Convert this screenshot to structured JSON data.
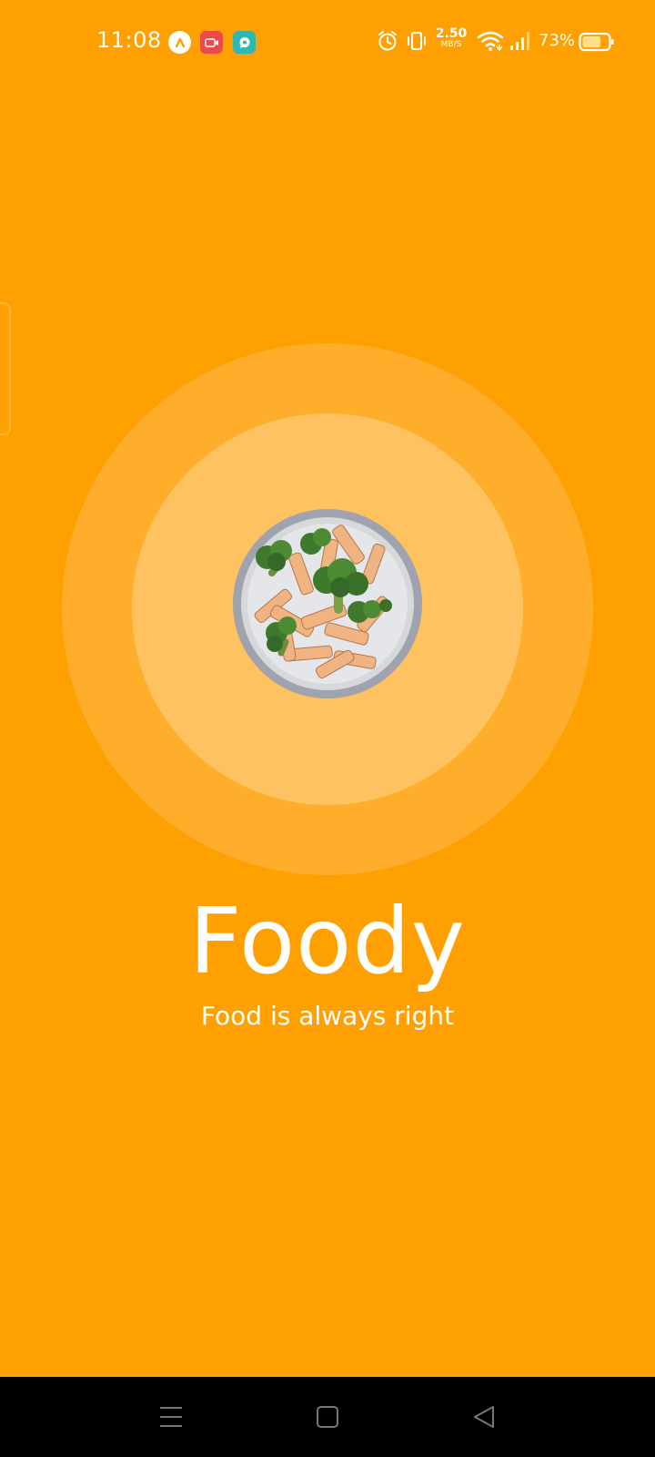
{
  "status_bar": {
    "time": "11:08",
    "notification_icons": [
      "assistant-a-icon",
      "screen-record-icon",
      "chat-bubble-icon"
    ],
    "system_icons": [
      "alarm-icon",
      "vibrate-icon",
      "wifi-icon",
      "cell-signal-icon",
      "battery-icon"
    ],
    "network_speed_value": "2.50",
    "network_speed_unit": "MB/S",
    "battery_percent": "73%",
    "battery_level": 0.73
  },
  "splash": {
    "app_name": "Foody",
    "tagline": "Food is always right",
    "logo_icon": "pasta-plate-icon"
  },
  "nav_bar": {
    "buttons": [
      "menu-icon",
      "home-icon",
      "back-icon"
    ]
  },
  "colors": {
    "background": "#FFA002",
    "outer_ring": "#FFAE2B",
    "inner_ring": "#FFC260",
    "text": "#FFFFFF",
    "nav_background": "#000000"
  }
}
